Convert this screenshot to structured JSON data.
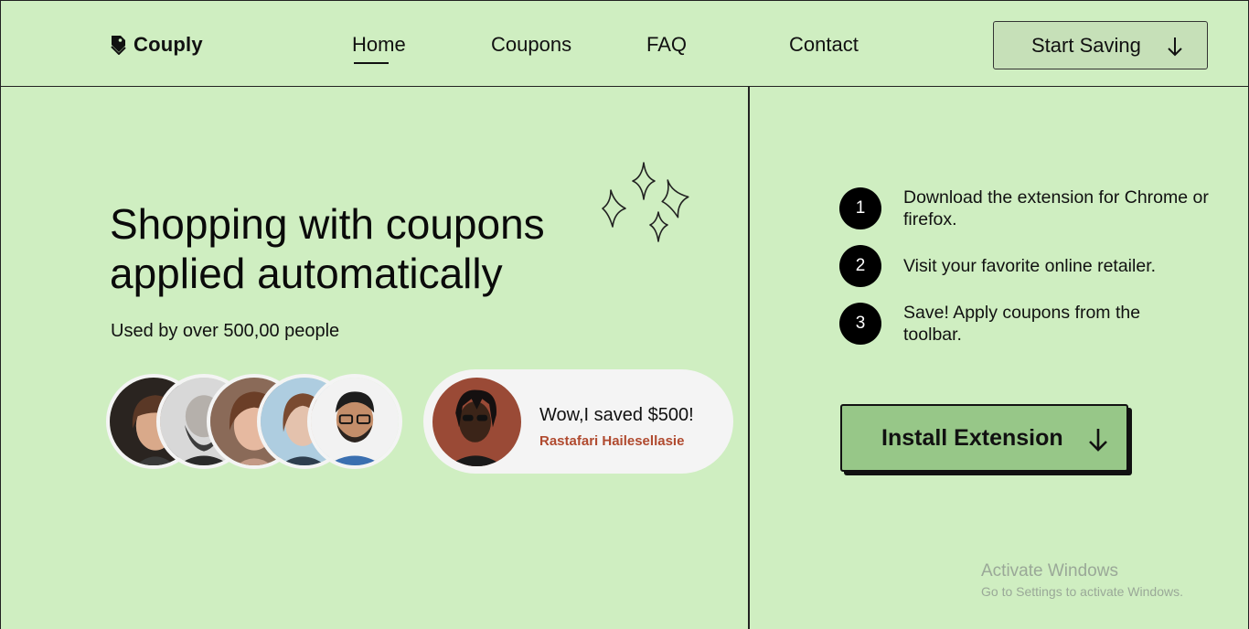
{
  "header": {
    "logo_text": "Couply",
    "logo_icon": "tag-icon",
    "nav": [
      {
        "label": "Home",
        "active": true
      },
      {
        "label": "Coupons",
        "active": false
      },
      {
        "label": "FAQ",
        "active": false
      },
      {
        "label": "Contact",
        "active": false
      }
    ],
    "cta_label": "Start Saving",
    "cta_icon": "arrow-down-icon"
  },
  "hero": {
    "title_line1": "Shopping with coupons",
    "title_line2": "applied automatically",
    "subtitle": "Used by over 500,00 people",
    "decoration_icon": "sparkles-icon"
  },
  "testimonial": {
    "quote": "Wow,I saved $500!",
    "name": "Rastafari Hailesellasie"
  },
  "steps": [
    {
      "number": "1",
      "text": "Download the extension for Chrome or firefox."
    },
    {
      "number": "2",
      "text": "Visit your favorite online retailer."
    },
    {
      "number": "3",
      "text": "Save! Apply coupons from the toolbar."
    }
  ],
  "install": {
    "label": "Install Extension",
    "icon": "arrow-down-icon"
  },
  "watermark": {
    "title": "Activate Windows",
    "subtitle": "Go to Settings to activate Windows."
  },
  "colors": {
    "background": "#cfeec1",
    "cta_background": "#c6e0b8",
    "install_background": "#97c788",
    "testimonial_name": "#b04a2f",
    "card_background": "#f4f4f4"
  }
}
